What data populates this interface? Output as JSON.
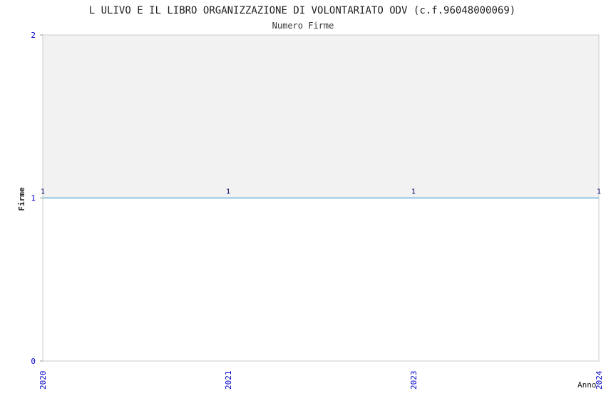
{
  "chart_data": {
    "type": "area",
    "title": "L ULIVO E IL LIBRO ORGANIZZAZIONE DI VOLONTARIATO ODV (c.f.96048000069)",
    "subtitle": "Numero Firme",
    "xlabel": "Anno",
    "ylabel": "Firme",
    "categories": [
      "2020",
      "2021",
      "2023",
      "2024"
    ],
    "values": [
      1,
      1,
      1,
      1
    ],
    "data_labels": [
      "1",
      "1",
      "1",
      "1"
    ],
    "y_ticks": [
      "0",
      "1",
      "2"
    ],
    "ylim": [
      0,
      2
    ],
    "grid": false,
    "colors": {
      "title": "#222222",
      "axis_text": "#0000cc",
      "line": "#4a9fd8",
      "band": "#f2f2f2",
      "frame": "#cccccc"
    }
  }
}
